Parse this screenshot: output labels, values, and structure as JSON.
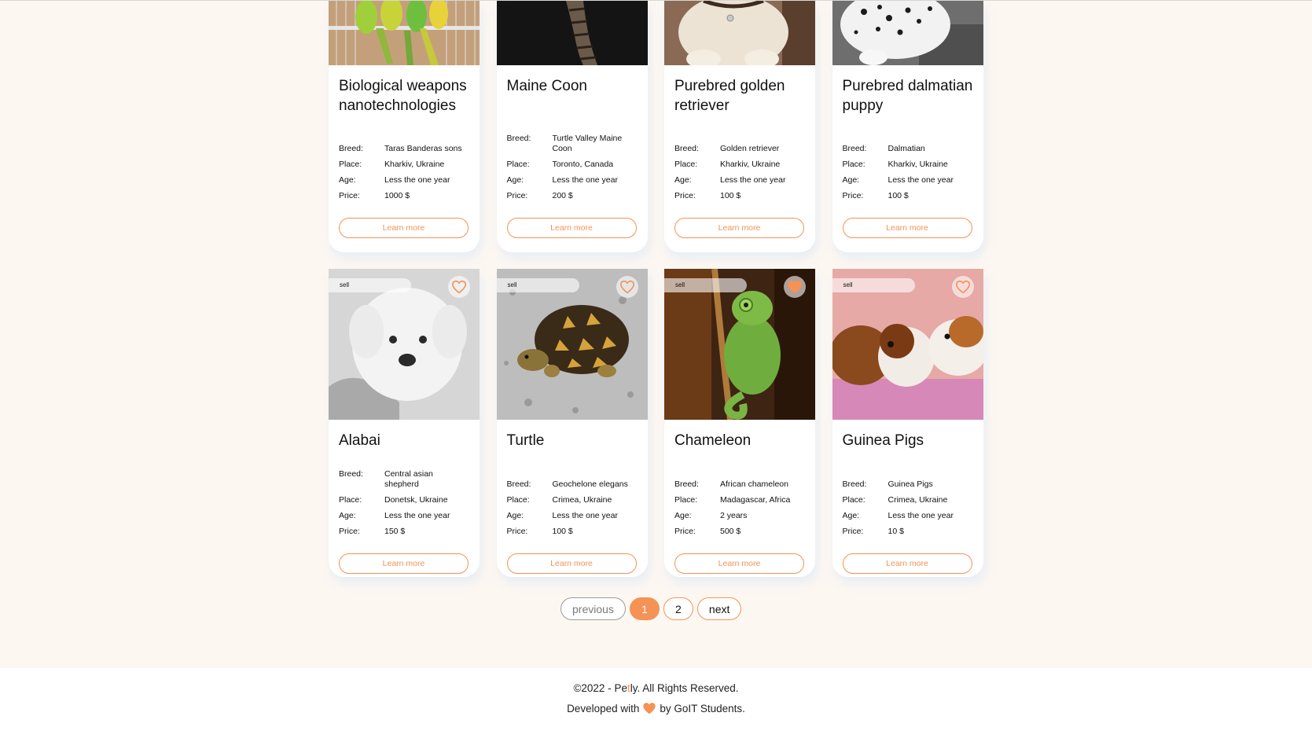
{
  "cards": [
    {
      "title": "Biological weapons nanotechnologies",
      "breed": "Taras Banderas sons",
      "place": "Kharkiv, Ukraine",
      "age": "Less the one year",
      "price": "1000 $",
      "image": "parrots"
    },
    {
      "title": "Maine Coon",
      "breed": "Turtle Valley Maine Coon",
      "place": "Toronto, Canada",
      "age": "Less the one year",
      "price": "200 $",
      "image": "cat-tail"
    },
    {
      "title": "Purebred golden retriever",
      "breed": "Golden retriever",
      "place": "Kharkiv, Ukraine",
      "age": "Less the one year",
      "price": "100 $",
      "image": "puppy"
    },
    {
      "title": "Purebred dalmatian puppy",
      "breed": "Dalmatian",
      "place": "Kharkiv, Ukraine",
      "age": "Less the one year",
      "price": "100 $",
      "image": "dalmatian"
    },
    {
      "title": "Alabai",
      "breed": "Central asian shepherd",
      "place": "Donetsk, Ukraine",
      "age": "Less the one year",
      "price": "150 $",
      "image": "white-puppy",
      "badge": "sell",
      "favorite": false
    },
    {
      "title": "Turtle",
      "breed": "Geochelone elegans",
      "place": "Crimea, Ukraine",
      "age": "Less the one year",
      "price": "100 $",
      "image": "tortoise",
      "badge": "sell",
      "favorite": false
    },
    {
      "title": "Chameleon",
      "breed": "African chameleon",
      "place": "Madagascar, Africa",
      "age": "2 years",
      "price": "500 $",
      "image": "chameleon",
      "badge": "sell",
      "favorite": true
    },
    {
      "title": "Guinea Pigs",
      "breed": "Guinea Pigs",
      "place": "Crimea, Ukraine",
      "age": "Less the one year",
      "price": "10 $",
      "image": "guinea-pigs",
      "badge": "sell",
      "favorite": false
    }
  ],
  "labels": {
    "breed": "Breed:",
    "place": "Place:",
    "age": "Age:",
    "price": "Price:",
    "learn_more": "Learn more"
  },
  "pagination": {
    "previous": "previous",
    "pages": [
      "1",
      "2"
    ],
    "current": "1",
    "next": "next"
  },
  "footer": {
    "copyright_prefix": "©2022 - ",
    "brand_pe": "Pe",
    "brand_t": "t",
    "brand_ly": "ly",
    "copyright_suffix": ". All Rights Reserved.",
    "developed_prefix": "Developed with",
    "developed_suffix": "by GoIT Students."
  },
  "colors": {
    "accent": "#f59256",
    "background": "#fdf7f2"
  }
}
